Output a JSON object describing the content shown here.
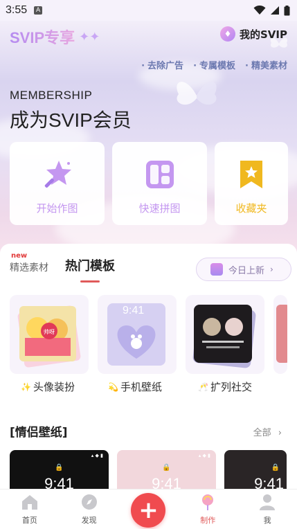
{
  "status_bar": {
    "time": "3:55",
    "notification": "A"
  },
  "header": {
    "brand": "SVIP专享",
    "my_svip_label": "我的SVIP"
  },
  "perks": [
    "去除广告",
    "专属模板",
    "精美素材"
  ],
  "hero": {
    "eyebrow": "MEMBERSHIP",
    "headline": "成为SVIP会员"
  },
  "feature_cards": [
    {
      "label": "开始作图",
      "icon": "star-wand-icon",
      "color": "#c497f0"
    },
    {
      "label": "快速拼图",
      "icon": "collage-grid-icon",
      "color": "#c497f0"
    },
    {
      "label": "收藏夹",
      "icon": "bookmark-star-icon",
      "color": "#f0b81f"
    }
  ],
  "tabs": {
    "new_badge": "new",
    "materials": "精选素材",
    "hot_templates": "热门模板"
  },
  "today_button": {
    "label": "今日上新",
    "arrow": "›"
  },
  "template_categories": [
    {
      "label": "头像装扮",
      "prefix": "✨"
    },
    {
      "label": "手机壁纸",
      "prefix": "💫"
    },
    {
      "label": "扩列社交",
      "prefix": "🥂"
    }
  ],
  "template_thumbs": {
    "card1_text": "帅呀",
    "card2_time": "9:41"
  },
  "couple_section": {
    "title": "[情侣壁纸]",
    "all_label": "全部"
  },
  "phone_previews": [
    {
      "time": "9:41",
      "bg": "#111111"
    },
    {
      "time": "9:41",
      "bg": "#f2d7dc"
    },
    {
      "time": "9:41",
      "bg": "#2a2526"
    }
  ],
  "bottom_nav": [
    {
      "label": "首页",
      "icon": "home-icon"
    },
    {
      "label": "发现",
      "icon": "compass-icon"
    },
    {
      "label": "",
      "icon": "plus-icon"
    },
    {
      "label": "制作",
      "icon": "lollipop-icon"
    },
    {
      "label": "我",
      "icon": "user-icon"
    }
  ],
  "accent": "#f04b4f"
}
